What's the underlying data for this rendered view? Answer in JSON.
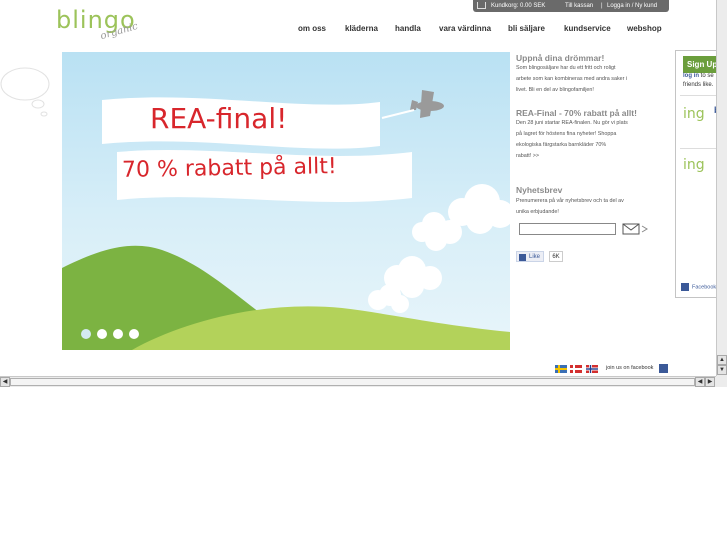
{
  "logo": {
    "word": "blingo",
    "sub": "organic"
  },
  "topbar": {
    "cart_label": "Kundkorg: 0.00 SEK",
    "checkout": "Till kassan",
    "sep": "|",
    "login": "Logga in / Ny kund"
  },
  "nav": [
    "om oss",
    "kläderna",
    "handla",
    "vara värdinna",
    "bli säljare",
    "kundservice",
    "webshop"
  ],
  "hero": {
    "line1": "REA-final!",
    "line2": "70 % rabatt på allt!",
    "dots": 4,
    "active_dot": 0
  },
  "sidebar": {
    "dream_title": "Uppnå dina drömmar!",
    "dream_text": [
      "Som blingosäljare har du ett fritt och roligt",
      "arbete som kan kombineras med andra saker i",
      "livet. Bli en del av blingofamiljen!"
    ],
    "rea_title": "REA-Final - 70% rabatt på allt!",
    "rea_text": [
      "Den 28 juni startar REA-finalen. Nu gör vi plats",
      "på lagret för höstens fina nyheter! Shoppa",
      "ekologiska färgstarka barnkläder 70%",
      "rabatt! >>"
    ],
    "news_title": "Nyhetsbrev",
    "news_text": [
      "Prenumerera på vår nyhetsbrev och ta del av",
      "unika erbjudande!"
    ],
    "news_value": "",
    "like_label": "Like",
    "like_count": "6K"
  },
  "fb_widget": {
    "signup": "Sign Up",
    "line1_link": "log in",
    "line1_rest": " to se",
    "line2": "friends like.",
    "ing": "ing",
    "b": "b",
    "footer": "Facebook"
  },
  "footer": {
    "join": "join us on facebook"
  },
  "colors": {
    "brand_green": "#9cc35a",
    "rea_red": "#d8262c",
    "facebook_blue": "#3b5998"
  }
}
